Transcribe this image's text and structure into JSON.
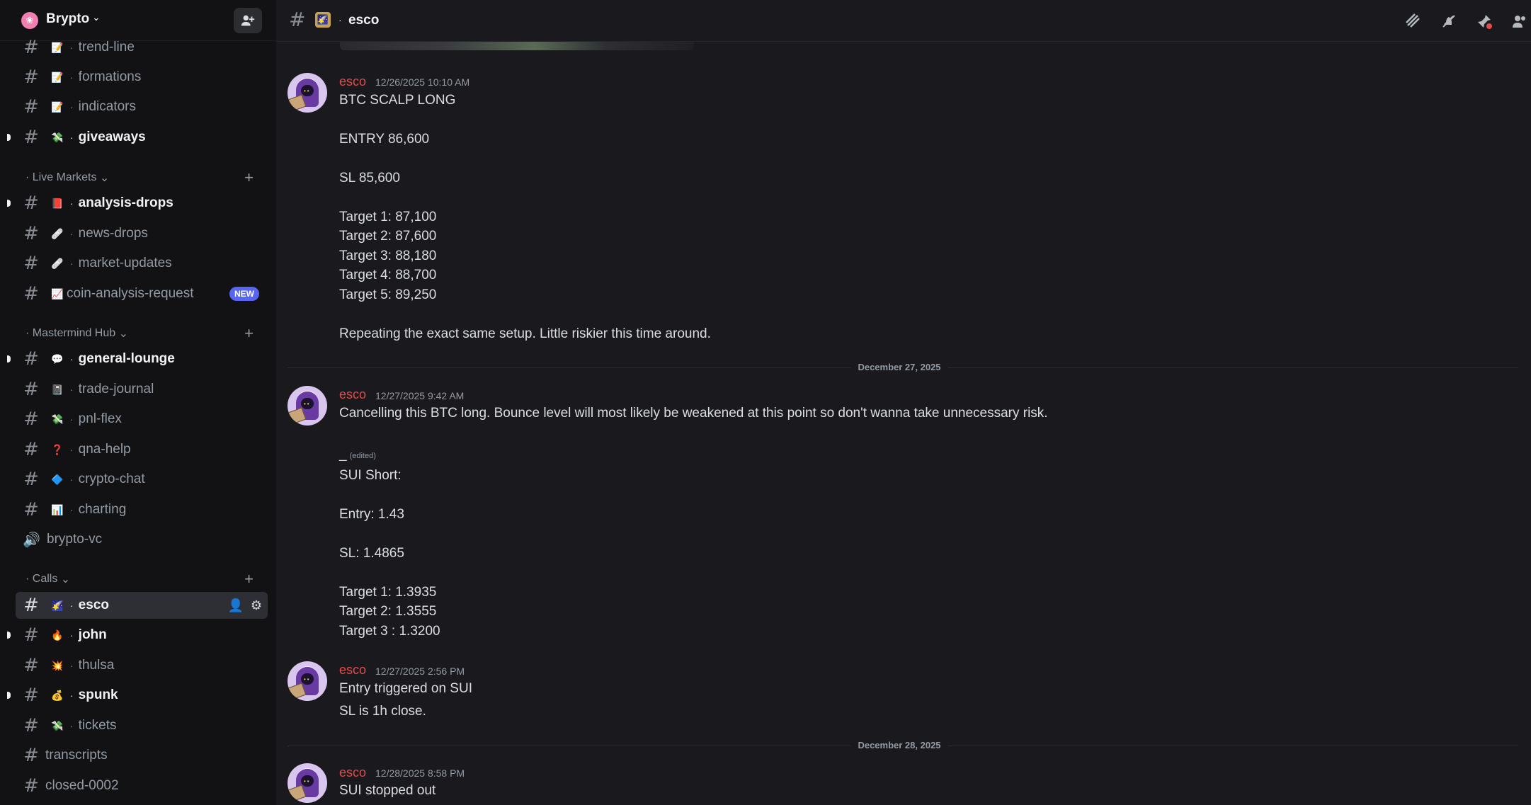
{
  "server": {
    "name": "Brypto"
  },
  "sidebar": {
    "channels_top": [
      {
        "name": "trend-line",
        "emoji": "📝",
        "unread": false
      },
      {
        "name": "formations",
        "emoji": "📝",
        "unread": false
      },
      {
        "name": "indicators",
        "emoji": "📝",
        "unread": false
      },
      {
        "name": "giveaways",
        "emoji": "💸",
        "unread": true
      }
    ],
    "categories": [
      {
        "name": "Live Markets",
        "channels": [
          {
            "name": "analysis-drops",
            "emoji": "📕",
            "unread": true
          },
          {
            "name": "news-drops",
            "emoji": "🩹",
            "unread": false
          },
          {
            "name": "market-updates",
            "emoji": "🩹",
            "unread": false
          },
          {
            "name": "coin-analysis-request",
            "emoji": "📈",
            "unread": false,
            "badge": "NEW"
          }
        ]
      },
      {
        "name": "Mastermind Hub",
        "channels": [
          {
            "name": "general-lounge",
            "emoji": "💬",
            "unread": true
          },
          {
            "name": "trade-journal",
            "emoji": "📓",
            "unread": false
          },
          {
            "name": "pnl-flex",
            "emoji": "💸",
            "unread": false
          },
          {
            "name": "qna-help",
            "emoji": "❓",
            "unread": false
          },
          {
            "name": "crypto-chat",
            "emoji": "🔷",
            "unread": false
          },
          {
            "name": "charting",
            "emoji": "📊",
            "unread": false
          },
          {
            "name": "brypto-vc",
            "type": "voice"
          }
        ]
      },
      {
        "name": "Calls",
        "channels": [
          {
            "name": "esco",
            "emoji": "🌠",
            "selected": true
          },
          {
            "name": "john",
            "emoji": "🔥",
            "unread": true
          },
          {
            "name": "thulsa",
            "emoji": "💥",
            "unread": false
          },
          {
            "name": "spunk",
            "emoji": "💰",
            "unread": true
          },
          {
            "name": "tickets",
            "emoji": "💸",
            "unread": false
          },
          {
            "name": "transcripts",
            "type": "locked"
          },
          {
            "name": "closed-0002",
            "type": "locked"
          }
        ]
      }
    ]
  },
  "header": {
    "channel": "esco",
    "emoji": "🌠"
  },
  "messages": [
    {
      "author": "esco",
      "time": "12/26/2025 10:10 AM",
      "lines": [
        "BTC SCALP LONG",
        "",
        "ENTRY 86,600",
        "",
        "SL 85,600",
        "",
        "Target 1: 87,100",
        "Target 2: 87,600",
        "Target 3: 88,180",
        "Target 4: 88,700",
        "Target 5: 89,250",
        "",
        "Repeating the exact same setup.  Little riskier this time around."
      ]
    },
    {
      "divider": "December 27, 2025"
    },
    {
      "author": "esco",
      "time": "12/27/2025 9:42 AM",
      "lines": [
        "Cancelling this BTC long.  Bounce level will most likely be weakened at this point so don't wanna take unnecessary risk."
      ],
      "edited_line": "_",
      "edited_label": "(edited)",
      "lines2": [
        "SUI Short:",
        "",
        "Entry: 1.43",
        "",
        "SL: 1.4865",
        "",
        "Target 1: 1.3935",
        "Target 2: 1.3555",
        "Target 3 : 1.3200"
      ]
    },
    {
      "author": "esco",
      "time": "12/27/2025 2:56 PM",
      "lines": [
        "Entry triggered on SUI",
        "SL is 1h close."
      ]
    },
    {
      "divider": "December 28, 2025"
    },
    {
      "author": "esco",
      "time": "12/28/2025 8:58 PM",
      "lines": [
        "SUI stopped out"
      ]
    }
  ],
  "colors": {
    "author": "#e34c4c",
    "accent": "#5865f2",
    "background": "#1a1a1e",
    "sidebar": "#121214"
  }
}
